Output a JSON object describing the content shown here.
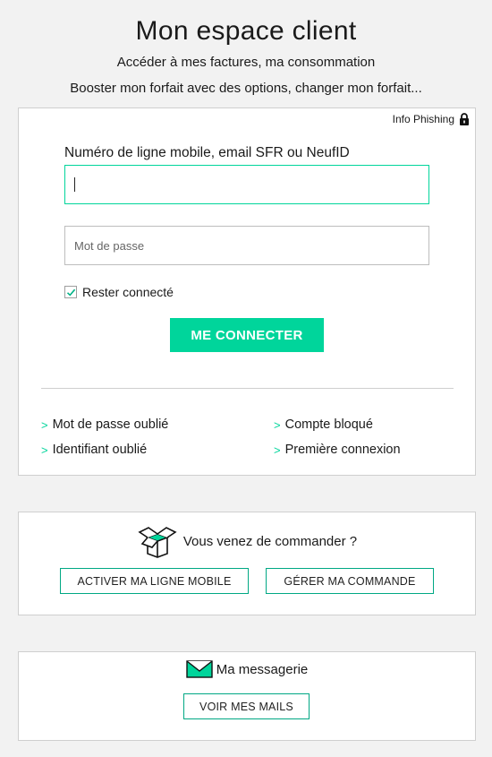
{
  "header": {
    "title": "Mon espace client",
    "subtitle1": "Accéder à mes factures, ma consommation",
    "subtitle2": "Booster mon forfait avec des options, changer mon forfait..."
  },
  "login": {
    "phishing_label": "Info Phishing",
    "login_label": "Numéro de ligne mobile, email SFR ou NeufID",
    "login_value": "",
    "password_placeholder": "Mot de passe",
    "remember_label": "Rester connecté",
    "remember_checked": true,
    "submit_label": "ME CONNECTER",
    "links": [
      {
        "label": "Mot de passe oublié"
      },
      {
        "label": "Compte bloqué"
      },
      {
        "label": "Identifiant oublié"
      },
      {
        "label": "Première connexion"
      }
    ]
  },
  "order": {
    "text": "Vous venez de commander ?",
    "activate_label": "ACTIVER MA LIGNE MOBILE",
    "manage_label": "GÉRER MA COMMANDE"
  },
  "mail": {
    "text": "Ma messagerie",
    "button_label": "VOIR MES MAILS"
  },
  "colors": {
    "accent": "#00d59b",
    "background": "#f2f2f2",
    "card_border": "#cfcfcf"
  }
}
